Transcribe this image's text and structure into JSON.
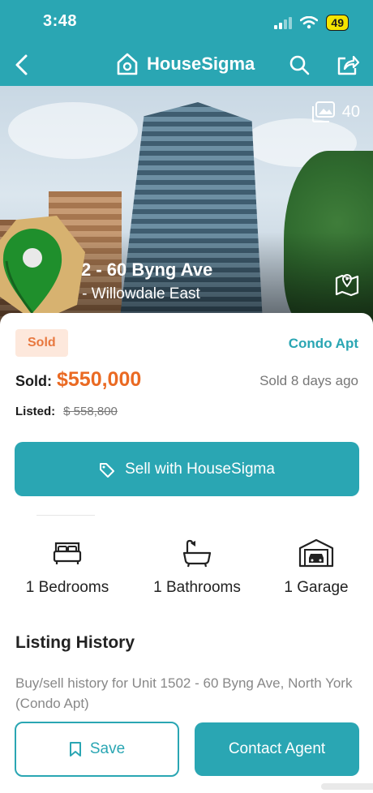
{
  "status_bar": {
    "time": "3:48",
    "battery": "49"
  },
  "nav": {
    "brand": "HouseSigma"
  },
  "hero": {
    "photo_count": "40",
    "address_line1": "2 - 60 Byng Ave",
    "address_line2": "rk - Willowdale East"
  },
  "listing": {
    "status_badge": "Sold",
    "property_type": "Condo Apt",
    "sold_label": "Sold:",
    "sold_price": "$550,000",
    "sold_ago": "Sold 8 days ago",
    "listed_label": "Listed:",
    "listed_price": "$ 558,800",
    "sell_button": "Sell with HouseSigma"
  },
  "features": [
    {
      "icon": "bed-icon",
      "label": "1 Bedrooms"
    },
    {
      "icon": "bathtub-icon",
      "label": "1 Bathrooms"
    },
    {
      "icon": "garage-icon",
      "label": "1 Garage"
    }
  ],
  "history": {
    "title": "Listing History",
    "description": "Buy/sell history for Unit 1502 - 60 Byng Ave, North York (Condo Apt)"
  },
  "actions": {
    "save": "Save",
    "contact": "Contact Agent"
  },
  "colors": {
    "teal": "#2aa6b3",
    "orange": "#ea6a23",
    "sold_badge_bg": "#fde8dc"
  }
}
